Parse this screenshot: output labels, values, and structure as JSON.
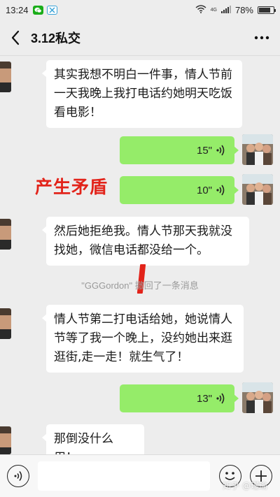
{
  "status_bar": {
    "time": "13:24",
    "network": "4G",
    "battery": "78%",
    "battery_level": 0.78
  },
  "header": {
    "title": "3.12私交"
  },
  "annotations": {
    "red_label": "产生矛盾"
  },
  "messages": [
    {
      "side": "left",
      "type": "text",
      "text": "其实我想不明白一件事，情人节前一天我晚上我打电话约她明天吃饭看电影！"
    },
    {
      "side": "right",
      "type": "voice",
      "duration": "15\""
    },
    {
      "side": "right",
      "type": "voice",
      "duration": "10\""
    },
    {
      "side": "left",
      "type": "text",
      "text": "然后她拒绝我。情人节那天我就没找她，微信电话都没给一个。"
    },
    {
      "side": "system",
      "type": "notice",
      "text": "\"GGGordon\" 撤回了一条消息"
    },
    {
      "side": "left",
      "type": "text",
      "text": "情人节第二打电话给她，她说情人节等了我一个晚上，没约她出来逛逛街,走一走！就生气了！"
    },
    {
      "side": "right",
      "type": "voice",
      "duration": "13\""
    },
    {
      "side": "left",
      "type": "text",
      "text": "那倒没什么用！"
    }
  ],
  "watermark": "知乎 @瑾瑜",
  "colors": {
    "voice_bubble": "#95ec69",
    "annotation": "#e2231a",
    "background": "#ededed"
  }
}
